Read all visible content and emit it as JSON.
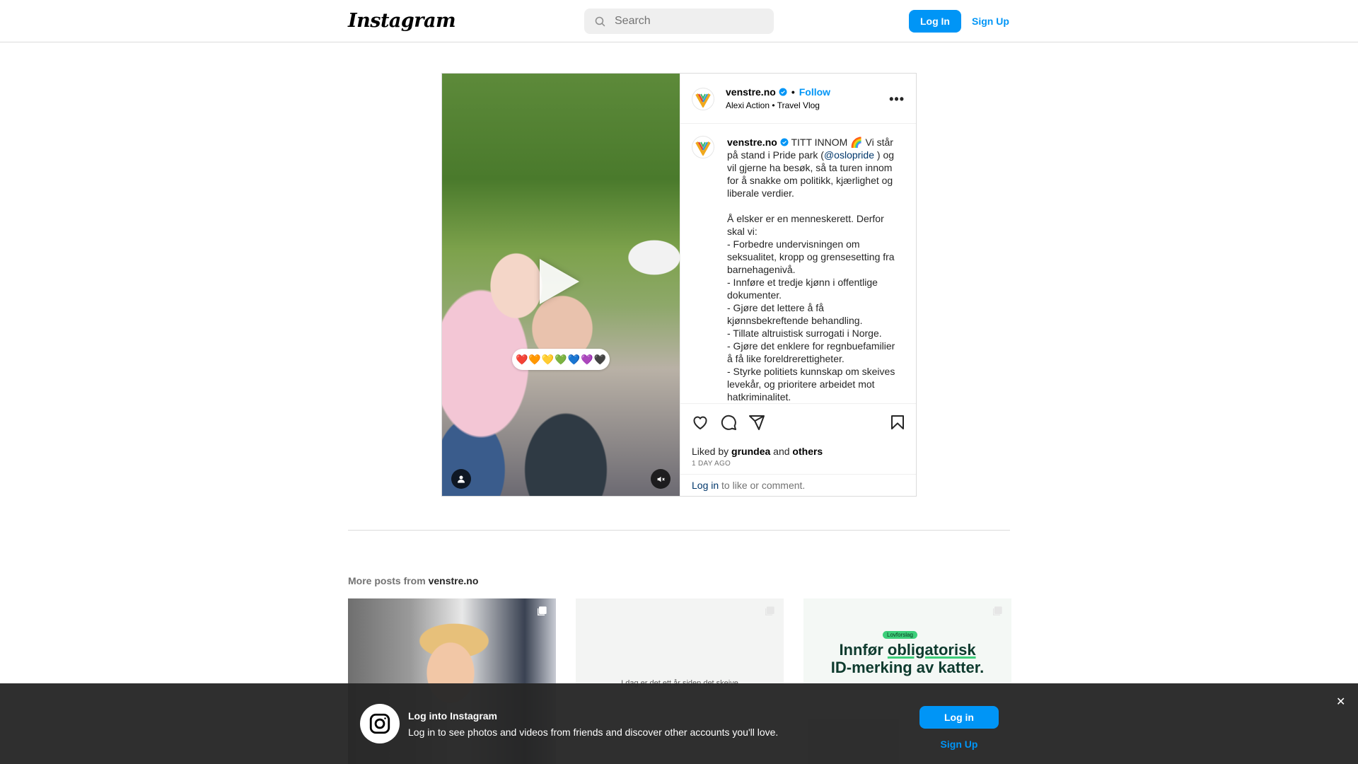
{
  "header": {
    "logo": "Instagram",
    "search_placeholder": "Search",
    "login_label": "Log In",
    "signup_label": "Sign Up"
  },
  "post": {
    "username": "venstre.no",
    "follow_label": "Follow",
    "audio": "Alexi Action",
    "audio_sep": "•",
    "audio_title": "Travel Vlog",
    "more_label": "•••",
    "caption_first": " TITT INNOM 🌈 Vi står på stand i Pride park (",
    "mention": "@oslopride",
    "caption_rest": " ) og vil gjerne ha besøk, så ta turen innom for å snakke om politikk, kjærlighet og liberale verdier.\n\nÅ elsker er en menneskerett. Derfor skal vi:\n- Forbedre undervisningen om seksualitet, kropp og grensesetting fra barnehagenivå.\n- Innføre et tredje kjønn i offentlige dokumenter.\n- Gjøre det lettere å få kjønnsbekreftende behandling.\n- Tillate altruistisk surrogati i Norge.\n- Gjøre det enklere for regnbuefamilier å få like foreldrerettigheter.\n- Styrke politiets kunnskap om skeives levekår, og prioritere arbeidet mot hatkriminalitet.",
    "sticker_hearts": [
      "❤️",
      "🧡",
      "💛",
      "💚",
      "💙",
      "💜",
      "🖤"
    ],
    "likes_prefix": "Liked by ",
    "likes_user": "grundea",
    "likes_and": " and ",
    "likes_others": "others",
    "time": "1 DAY AGO",
    "login_link": "Log in",
    "login_suffix": " to like or comment."
  },
  "more_posts": {
    "prefix": "More posts from ",
    "username": "venstre.no",
    "thumb2_text": "I dag er det ett år siden det skeive",
    "thumb3_tag": "Lovforslag",
    "thumb3_title_pre": "Innfør ",
    "thumb3_title_u": "obligatorisk",
    "thumb3_title_line2": "ID-merking av katter."
  },
  "banner": {
    "title": "Log into Instagram",
    "text": "Log in to see photos and videos from friends and discover other accounts you'll love.",
    "login_label": "Log in",
    "signup_label": "Sign Up",
    "close_label": "✕"
  },
  "colors": {
    "accent": "#0095f6",
    "link_dark": "#00376b",
    "banner_bg": "#262626"
  }
}
